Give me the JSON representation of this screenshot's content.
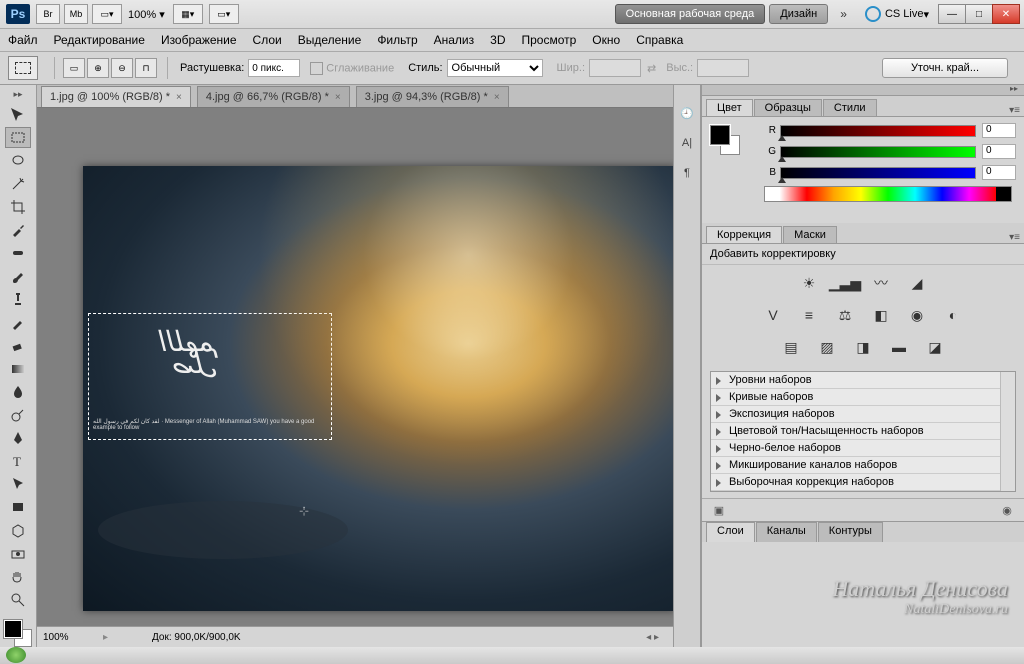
{
  "titlebar": {
    "br_label": "Br",
    "mb_label": "Mb",
    "zoom": "100%",
    "workspace_active": "Основная рабочая среда",
    "workspace_design": "Дизайн",
    "cs_live": "CS Live"
  },
  "menu": {
    "items": [
      "Файл",
      "Редактирование",
      "Изображение",
      "Слои",
      "Выделение",
      "Фильтр",
      "Анализ",
      "3D",
      "Просмотр",
      "Окно",
      "Справка"
    ]
  },
  "options": {
    "feather_label": "Растушевка:",
    "feather_value": "0 пикс.",
    "antialias_label": "Сглаживание",
    "style_label": "Стиль:",
    "style_value": "Обычный",
    "width_label": "Шир.:",
    "height_label": "Выс.:",
    "refine_label": "Уточн. край..."
  },
  "doc_tabs": [
    {
      "label": "1.jpg @ 100% (RGB/8) *",
      "active": true
    },
    {
      "label": "4.jpg @ 66,7% (RGB/8) *",
      "active": false
    },
    {
      "label": "3.jpg @ 94,3% (RGB/8) *",
      "active": false
    }
  ],
  "color_panel": {
    "tabs": [
      "Цвет",
      "Образцы",
      "Стили"
    ],
    "r_label": "R",
    "g_label": "G",
    "b_label": "B",
    "r": "0",
    "g": "0",
    "b": "0"
  },
  "adjustments": {
    "tabs": [
      "Коррекция",
      "Маски"
    ],
    "header": "Добавить корректировку",
    "presets": [
      "Уровни наборов",
      "Кривые наборов",
      "Экспозиция наборов",
      "Цветовой тон/Насыщенность наборов",
      "Черно-белое наборов",
      "Микширование каналов наборов",
      "Выборочная коррекция наборов"
    ]
  },
  "layer_panel": {
    "tabs": [
      "Слои",
      "Каналы",
      "Контуры"
    ]
  },
  "status": {
    "zoom": "100%",
    "doc": "Док: 900,0K/900,0K"
  },
  "watermark": {
    "line1": "Наталья Денисова",
    "line2": "NataliDenisova.ru"
  }
}
